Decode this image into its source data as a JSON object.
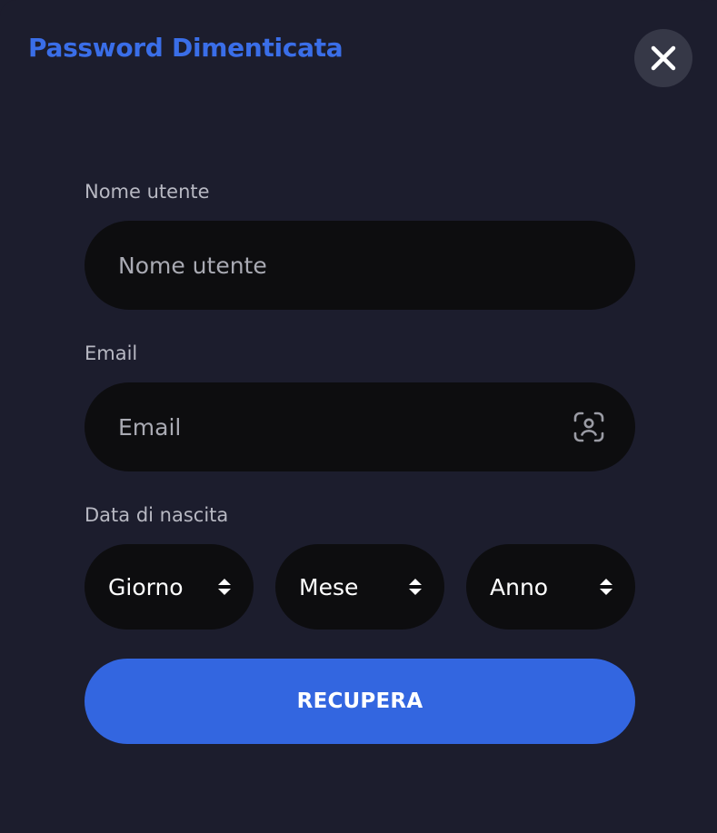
{
  "modal": {
    "title": "Password Dimenticata"
  },
  "icons": {
    "close": "close-icon",
    "email_field": "face-scan-icon",
    "select_arrows": "sort-arrows-icon"
  },
  "form": {
    "username": {
      "label": "Nome utente",
      "placeholder": "Nome utente",
      "value": ""
    },
    "email": {
      "label": "Email",
      "placeholder": "Email",
      "value": ""
    },
    "birthdate": {
      "label": "Data di nascita",
      "day": "Giorno",
      "month": "Mese",
      "year": "Anno"
    },
    "submit_label": "RECUPERA"
  },
  "colors": {
    "background": "#1c1d2d",
    "accent": "#3366e0",
    "title": "#3a6ee8",
    "field_bg": "#0d0d0f",
    "close_bg": "#363847"
  }
}
